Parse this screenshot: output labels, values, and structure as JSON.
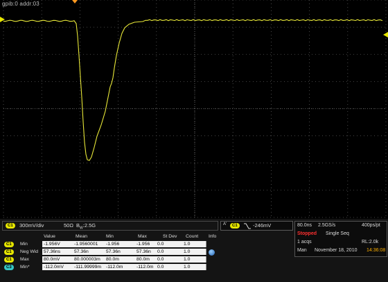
{
  "device": {
    "address": "gpib:0  addr:03"
  },
  "colors": {
    "ch1": "#e6e600",
    "ch3": "#36c6c6",
    "trace": "#e8e838",
    "stopped": "#ff3030",
    "time": "#ffb000"
  },
  "channel_bar": {
    "channel": "C1",
    "volts_div": "300mV/div",
    "impedance": "50Ω",
    "bandwidth_prefix": "B",
    "bandwidth_sub": "W",
    "bandwidth": ":2.5G"
  },
  "trigger": {
    "marker": "A'",
    "channel": "C1",
    "edge_icon": "falling-edge-icon",
    "level": "-246mV"
  },
  "acquisition": {
    "timebase": "80.0ns",
    "sample_rate": "2.5GS/s",
    "resolution": "400ps/pt",
    "state": "Stopped",
    "mode": "Single Seq",
    "acqs": "1 acqs",
    "record_length": "RL:2.0k",
    "trigger_mode": "Man",
    "date": "November 18, 2010",
    "time": "14:36:08"
  },
  "measurements": {
    "headers": [
      "Value",
      "Mean",
      "Min",
      "Max",
      "St Dev",
      "Count",
      "Info"
    ],
    "rows": [
      {
        "chip": "C1",
        "label": "Min",
        "value": "-1.956V",
        "mean": "-1.9560001",
        "min": "-1.956",
        "max": "-1.956",
        "stdev": "0.0",
        "count": "1.0"
      },
      {
        "chip": "C1",
        "label": "Neg Wid",
        "value": "57.36ns",
        "mean": "57.36n",
        "min": "57.36n",
        "max": "57.36n",
        "stdev": "0.0",
        "count": "1.0"
      },
      {
        "chip": "C1",
        "label": "Max",
        "value": "80.0mV",
        "mean": "80.000003m",
        "min": "80.0m",
        "max": "80.0m",
        "stdev": "0.0",
        "count": "1.0"
      },
      {
        "chip": "C3",
        "label": "Min*",
        "value": "-112.0mV",
        "mean": "-111.99999m",
        "min": "-112.0m",
        "max": "-112.0m",
        "stdev": "0.0",
        "count": "1.0"
      }
    ],
    "info_icon": "info-icon"
  }
}
